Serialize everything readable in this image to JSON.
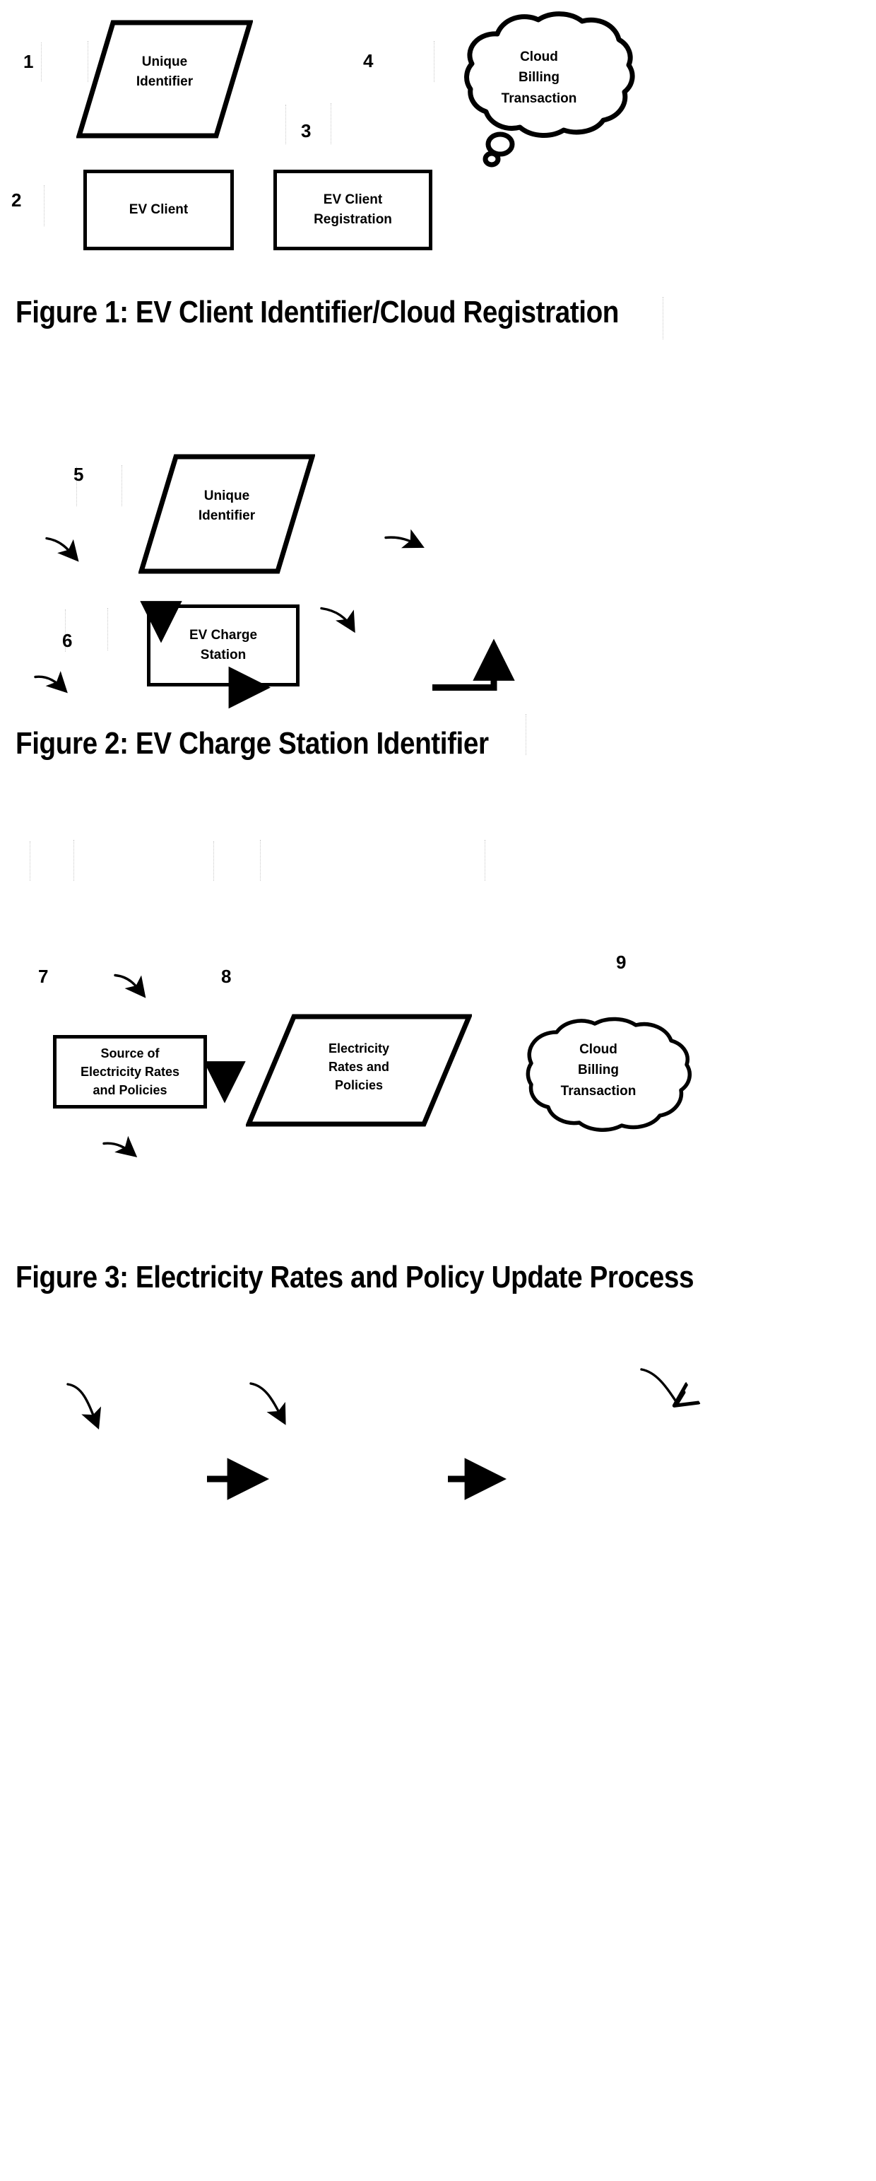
{
  "document": {
    "type": "patent-figure-sheet",
    "background_color": "#ffffff",
    "ink_color": "#000000"
  },
  "figures": [
    {
      "id": "figure-1",
      "caption": "Figure 1: EV Client Identifier/Cloud Registration",
      "nodes": [
        {
          "ref": "1",
          "shape": "parallelogram",
          "label_lines": [
            "Unique",
            "Identifier"
          ]
        },
        {
          "ref": "2",
          "shape": "rectangle",
          "label_lines": [
            "EV Client"
          ]
        },
        {
          "ref": "3",
          "shape": "rectangle",
          "label_lines": [
            "EV Client",
            "Registration"
          ]
        },
        {
          "ref": "4",
          "shape": "cloud",
          "label_lines": [
            "Cloud",
            "Billing",
            "Transaction"
          ]
        }
      ],
      "ref_numbers": [
        "1",
        "2",
        "3",
        "4"
      ],
      "flows": [
        {
          "from": "Unique Identifier",
          "to": "EV Client"
        },
        {
          "from": "EV Client",
          "to": "EV Client Registration"
        },
        {
          "from": "EV Client Registration",
          "to": "Cloud Billing Transaction"
        }
      ]
    },
    {
      "id": "figure-2",
      "caption": "Figure 2: EV Charge Station Identifier",
      "nodes": [
        {
          "ref": "5",
          "shape": "parallelogram",
          "label_lines": [
            "Unique",
            "Identifier"
          ]
        },
        {
          "ref": "6",
          "shape": "rectangle",
          "label_lines": [
            "EV Charge",
            "Station"
          ]
        }
      ],
      "ref_numbers": [
        "5",
        "6"
      ],
      "flows": [
        {
          "from": "Unique Identifier",
          "to": "EV Charge Station"
        }
      ]
    },
    {
      "id": "figure-3",
      "caption": "Figure 3: Electricity Rates and Policy Update Process",
      "nodes": [
        {
          "ref": "7",
          "shape": "rectangle",
          "label_lines": [
            "Source of",
            "Electricity Rates",
            "and  Policies"
          ]
        },
        {
          "ref": "8",
          "shape": "parallelogram",
          "label_lines": [
            "Electricity",
            "Rates and",
            "Policies"
          ]
        },
        {
          "ref": "9",
          "shape": "cloud",
          "label_lines": [
            "Cloud",
            "Billing",
            "Transaction"
          ]
        }
      ],
      "ref_numbers": [
        "7",
        "8",
        "9"
      ],
      "flows": [
        {
          "from": "Source of Electricity Rates and Policies",
          "to": "Electricity Rates and Policies"
        },
        {
          "from": "Electricity Rates and Policies",
          "to": "Cloud Billing Transaction"
        }
      ]
    }
  ],
  "fig1": {
    "caption": "Figure 1: EV Client Identifier/Cloud Registration",
    "ref1": "1",
    "ref2": "2",
    "ref3": "3",
    "ref4": "4",
    "unique_identifier_line1": "Unique",
    "unique_identifier_line2": "Identifier",
    "ev_client": "EV Client",
    "ev_client_reg_line1": "EV Client",
    "ev_client_reg_line2": "Registration",
    "cloud_line1": "Cloud",
    "cloud_line2": "Billing",
    "cloud_line3": "Transaction"
  },
  "fig2": {
    "caption": "Figure 2: EV Charge Station Identifier",
    "ref5": "5",
    "ref6": "6",
    "unique_identifier_line1": "Unique",
    "unique_identifier_line2": "Identifier",
    "charge_station_line1": "EV Charge",
    "charge_station_line2": "Station"
  },
  "fig3": {
    "caption": "Figure 3: Electricity Rates and Policy Update Process",
    "ref7": "7",
    "ref8": "8",
    "ref9": "9",
    "source_line1": "Source of",
    "source_line2": "Electricity Rates",
    "source_line3": "and  Policies",
    "rates_line1": "Electricity",
    "rates_line2": "Rates and",
    "rates_line3": "Policies",
    "cloud_line1": "Cloud",
    "cloud_line2": "Billing",
    "cloud_line3": "Transaction"
  }
}
